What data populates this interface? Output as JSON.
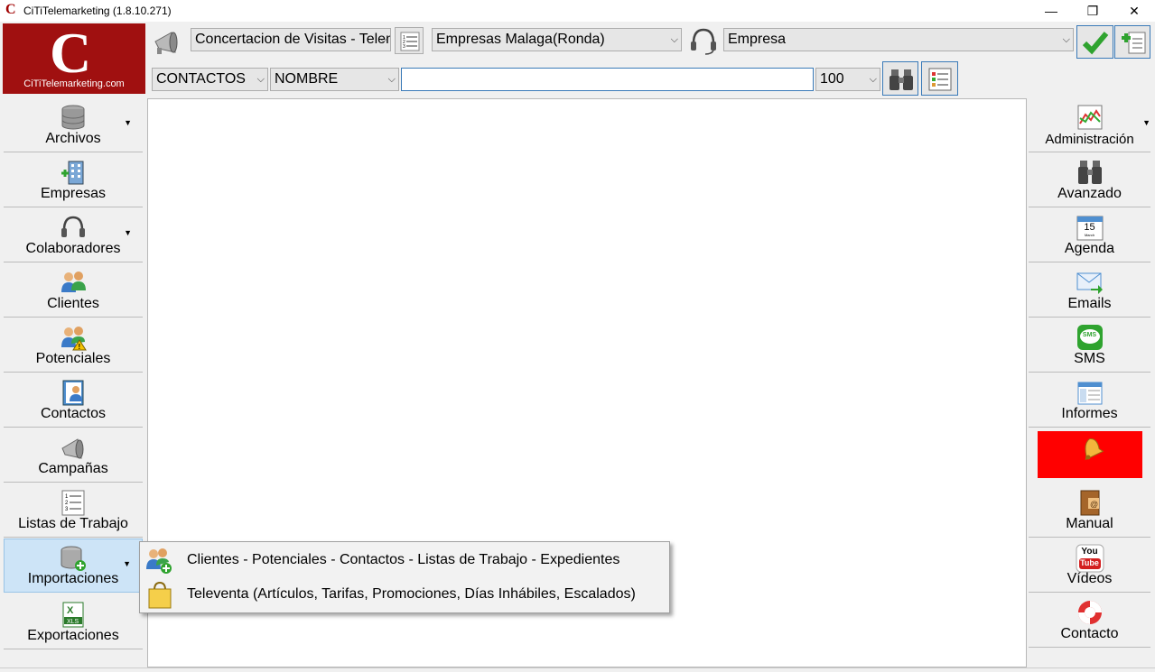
{
  "window": {
    "title": "CiTiTelemarketing  (1.8.10.271)",
    "app_icon_letter": "C",
    "controls": {
      "minimize": "—",
      "maximize": "❐",
      "close": "✕"
    }
  },
  "logo": {
    "letter": "C",
    "site": "CiTiTelemarketing.com",
    "color": "#a01010"
  },
  "toolbar": {
    "campaign_value": "Concertacion de Visitas - Telemarketing",
    "list_value": "Empresas Malaga(Ronda)",
    "type_value": "Empresa"
  },
  "search": {
    "table_value": "CONTACTOS",
    "field_value": "NOMBRE",
    "query_value": "",
    "limit_value": "100"
  },
  "left_menu": [
    {
      "label": "Archivos",
      "icon": "database-icon",
      "has_dropdown": true
    },
    {
      "label": "Empresas",
      "icon": "building-icon",
      "has_dropdown": false
    },
    {
      "label": "Colaboradores",
      "icon": "headset-icon",
      "has_dropdown": true
    },
    {
      "label": "Clientes",
      "icon": "users-icon",
      "has_dropdown": false
    },
    {
      "label": "Potenciales",
      "icon": "users-warning-icon",
      "has_dropdown": false
    },
    {
      "label": "Contactos",
      "icon": "contact-book-icon",
      "has_dropdown": false
    },
    {
      "label": "Campañas",
      "icon": "megaphone-icon",
      "has_dropdown": false
    },
    {
      "label": "Listas de Trabajo",
      "icon": "numbered-list-icon",
      "has_dropdown": false
    },
    {
      "label": "Importaciones",
      "icon": "database-add-icon",
      "has_dropdown": true,
      "active": true
    },
    {
      "label": "Exportaciones",
      "icon": "excel-xls-icon",
      "has_dropdown": false
    }
  ],
  "right_menu": [
    {
      "label": "Administración",
      "icon": "chart-icon",
      "has_dropdown": true
    },
    {
      "label": "Avanzado",
      "icon": "binoculars-icon"
    },
    {
      "label": "Agenda",
      "icon": "calendar-icon",
      "calendar_day": "15",
      "calendar_month": "March"
    },
    {
      "label": "Emails",
      "icon": "email-icon"
    },
    {
      "label": "SMS",
      "icon": "sms-icon",
      "badge": "SMS"
    },
    {
      "label": "Informes",
      "icon": "report-icon"
    },
    {
      "label": "",
      "icon": "bell-icon",
      "background": "#ff0000"
    },
    {
      "label": "Manual",
      "icon": "manual-book-icon"
    },
    {
      "label": "Vídeos",
      "icon": "youtube-icon",
      "badge_top": "You",
      "badge_bottom": "Tube"
    },
    {
      "label": "Contacto",
      "icon": "lifebuoy-icon"
    }
  ],
  "popup_menu": [
    {
      "label": "Clientes - Potenciales - Contactos - Listas de Trabajo - Expedientes",
      "icon": "users-add-icon"
    },
    {
      "label": "Televenta (Artículos, Tarifas, Promociones, Días Inhábiles, Escalados)",
      "icon": "shopping-bag-icon"
    }
  ]
}
